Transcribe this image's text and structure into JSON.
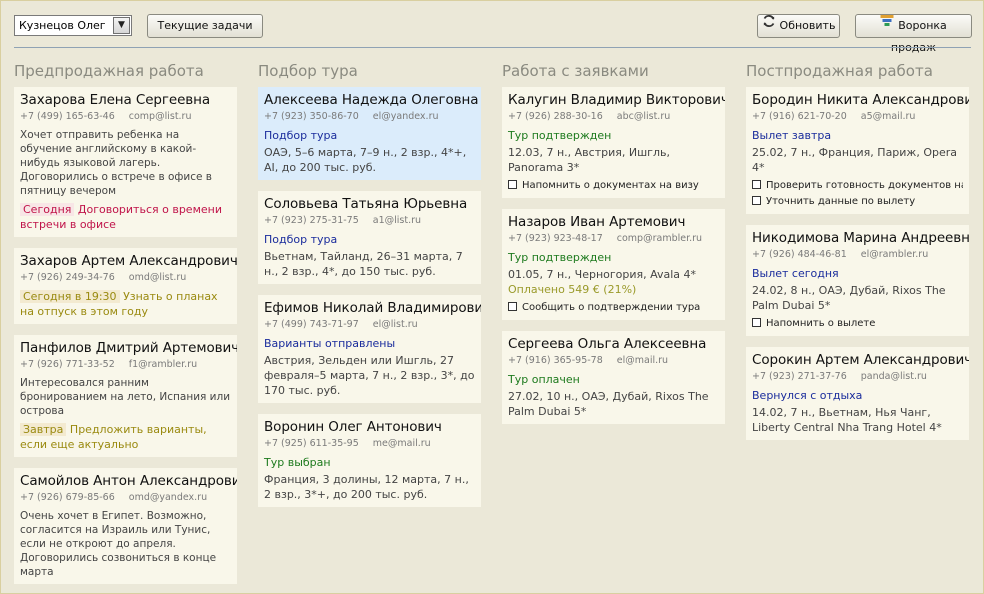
{
  "toolbar": {
    "user_select": "Кузнецов Олег",
    "current_tasks": "Текущие задачи",
    "refresh": "Обновить",
    "sales_funnel": "Воронка продаж"
  },
  "columns": [
    {
      "title": "Предпродажная работа",
      "cards": [
        {
          "name": "Захарова Елена Сергеевна",
          "phone": "+7 (499) 165-63-46",
          "email": "comp@list.ru",
          "note": "Хочет отправить ребенка на обучение английскому в какой-нибудь языковой лагерь. Договорились о встрече в офисе в пятницу вечером",
          "reminder_tag": "Сегодня",
          "reminder_text": "Договориться о времени встречи в офисе"
        },
        {
          "name": "Захаров Артем Александрович",
          "phone": "+7 (926) 249-34-76",
          "email": "omd@list.ru",
          "reminder_tag": "Сегодня в 19:30",
          "reminder_text": "Узнать о планах на отпуск в этом году"
        },
        {
          "name": "Панфилов Дмитрий Артемович",
          "phone": "+7 (926) 771-33-52",
          "email": "f1@rambler.ru",
          "note": "Интересовался ранним бронированием на лето, Испания или острова",
          "reminder_tag": "Завтра",
          "reminder_text": "Предложить варианты, если еще актуально"
        },
        {
          "name": "Самойлов Антон Александрович",
          "phone": "+7 (926) 679-85-66",
          "email": "omd@yandex.ru",
          "note": "Очень хочет в Египет. Возможно, согласится на Израиль или Тунис, если не откроют до апреля. Договорились созвониться в конце марта"
        }
      ]
    },
    {
      "title": "Подбор тура",
      "cards": [
        {
          "name": "Алексеева Надежда Олеговна",
          "phone": "+7 (923) 350-86-70",
          "email": "el@yandex.ru",
          "status": "Подбор тура",
          "details": "ОАЭ, 5–6 марта, 7–9 н., 2 взр., 4*+, AI, до 200 тыс. руб."
        },
        {
          "name": "Соловьева Татьяна Юрьевна",
          "phone": "+7 (923) 275-31-75",
          "email": "a1@list.ru",
          "status": "Подбор тура",
          "details": "Вьетнам, Тайланд, 26–31 марта, 7 н., 2 взр., 4*, до 150 тыс. руб."
        },
        {
          "name": "Ефимов Николай Владимирович",
          "phone": "+7 (499) 743-71-97",
          "email": "el@list.ru",
          "status": "Варианты отправлены",
          "details": "Австрия, Зельден или Ишгль, 27 февраля–5 марта, 7 н., 2 взр., 3*, до 170 тыс. руб."
        },
        {
          "name": "Воронин Олег Антонович",
          "phone": "+7 (925) 611-35-95",
          "email": "me@mail.ru",
          "status": "Тур выбран",
          "details": "Франция, 3 долины, 12 марта, 7 н., 2 взр., 3*+, до 200 тыс. руб."
        }
      ]
    },
    {
      "title": "Работа с заявками",
      "cards": [
        {
          "name": "Калугин Владимир Викторович",
          "phone": "+7 (926) 288-30-16",
          "email": "abc@list.ru",
          "status": "Тур подтвержден",
          "details": "12.03, 7 н., Австрия, Ишгль, Panorama 3*",
          "checks": [
            "Напомнить о документах на визу"
          ]
        },
        {
          "name": "Назаров Иван Артемович",
          "phone": "+7 (923) 923-48-17",
          "email": "comp@rambler.ru",
          "status": "Тур подтвержден",
          "details": "01.05, 7 н., Черногория, Avala 4*",
          "extra": "Оплачено 549 € (21%)",
          "checks": [
            "Сообщить о подтверждении тура"
          ]
        },
        {
          "name": "Сергеева Ольга Алексеевна",
          "phone": "+7 (916) 365-95-78",
          "email": "el@mail.ru",
          "status": "Тур оплачен",
          "details": "27.02, 10 н., ОАЭ, Дубай, Rixos The Palm Dubai 5*"
        }
      ]
    },
    {
      "title": "Постпродажная работа",
      "cards": [
        {
          "name": "Бородин Никита Александрович",
          "phone": "+7 (916) 621-70-20",
          "email": "a5@mail.ru",
          "status": "Вылет завтра",
          "details": "25.02, 7 н., Франция, Париж, Opera 4*",
          "checks": [
            "Проверить готовность документов на...",
            "Уточнить данные по вылету"
          ]
        },
        {
          "name": "Никодимова Марина Андреевна",
          "phone": "+7 (926) 484-46-81",
          "email": "el@rambler.ru",
          "status": "Вылет сегодня",
          "details": "24.02, 8 н., ОАЭ, Дубай, Rixos The Palm Dubai 5*",
          "checks": [
            "Напомнить о вылете"
          ]
        },
        {
          "name": "Сорокин Артем Александрович",
          "phone": "+7 (923) 271-37-76",
          "email": "panda@list.ru",
          "status": "Вернулся с отдыха",
          "details": "14.02, 7 н., Вьетнам, Нья Чанг, Liberty Central Nha Trang Hotel 4*"
        }
      ]
    }
  ]
}
